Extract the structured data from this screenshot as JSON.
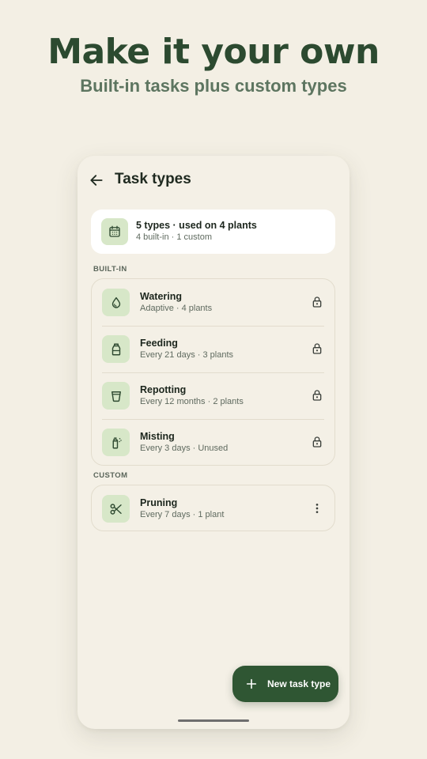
{
  "promo": {
    "headline": "Make it your own",
    "subheadline": "Built-in tasks plus custom types"
  },
  "appbar": {
    "title": "Task types"
  },
  "summary": {
    "title": "5 types · used on 4 plants",
    "subtitle": "4 built-in · 1 custom"
  },
  "sections": {
    "builtin_label": "BUILT-IN",
    "custom_label": "CUSTOM"
  },
  "builtin": [
    {
      "name": "Watering",
      "detail": "Adaptive · 4 plants",
      "icon": "water-drop-icon"
    },
    {
      "name": "Feeding",
      "detail": "Every 21 days · 3 plants",
      "icon": "fertilizer-bottle-icon"
    },
    {
      "name": "Repotting",
      "detail": "Every 12 months · 2 plants",
      "icon": "pot-icon"
    },
    {
      "name": "Misting",
      "detail": "Every 3 days · Unused",
      "icon": "spray-bottle-icon"
    }
  ],
  "custom": [
    {
      "name": "Pruning",
      "detail": "Every 7 days · 1 plant",
      "icon": "scissors-icon"
    }
  ],
  "fab": {
    "label": "New task type"
  },
  "colors": {
    "background": "#f3efe4",
    "accent": "#2f5633",
    "headline": "#2c4a30",
    "icon_tile": "#d7e7c8"
  }
}
